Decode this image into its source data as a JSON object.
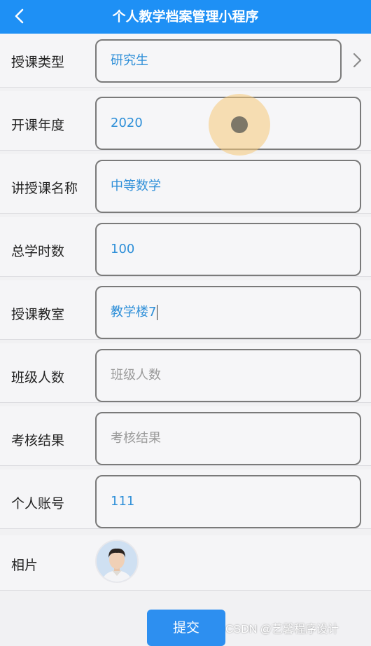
{
  "navbar": {
    "title": "个人教学档案管理小程序"
  },
  "form": {
    "rows": [
      {
        "label": "授课类型",
        "value": "研究生",
        "placeholder": ""
      },
      {
        "label": "开课年度",
        "value": "2020",
        "placeholder": ""
      },
      {
        "label": "讲授课名称",
        "value": "中等数学",
        "placeholder": ""
      },
      {
        "label": "总学时数",
        "value": "100",
        "placeholder": ""
      },
      {
        "label": "授课教室",
        "value": "教学楼7",
        "placeholder": ""
      },
      {
        "label": "班级人数",
        "value": "",
        "placeholder": "班级人数"
      },
      {
        "label": "考核结果",
        "value": "",
        "placeholder": "考核结果"
      },
      {
        "label": "个人账号",
        "value": "111",
        "placeholder": ""
      }
    ],
    "photo_label": "相片"
  },
  "submit_label": "提交",
  "watermark": "CSDN @艺馨程序设计",
  "colors": {
    "accent": "#1e90f5",
    "value_text": "#2e8fd8"
  },
  "icons": {
    "back": "chevron-left-icon",
    "picker": "chevron-right-icon"
  }
}
